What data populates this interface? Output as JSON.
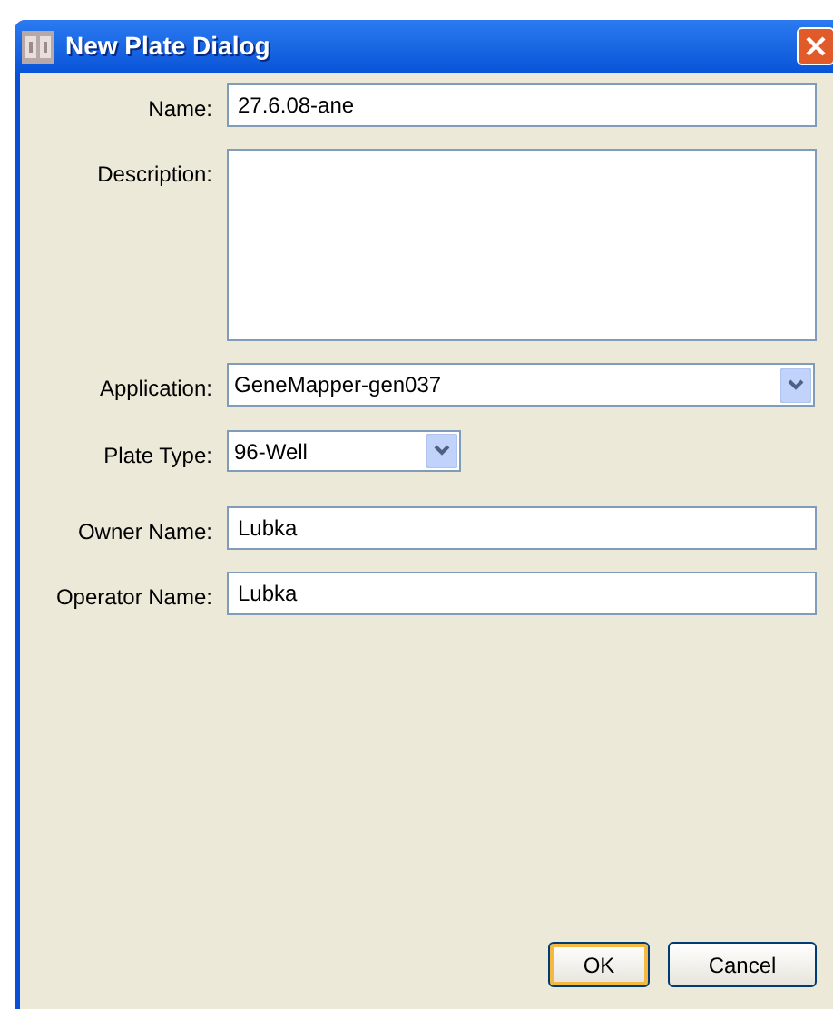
{
  "window": {
    "title": "New Plate Dialog"
  },
  "fields": [
    {
      "kind": "text",
      "label": "Name:",
      "value": "27.6.08-ane"
    },
    {
      "kind": "textarea",
      "label": "Description:"
    },
    {
      "kind": "dropdown",
      "label": "Application:",
      "value": "GeneMapper-gen037"
    },
    {
      "kind": "dropdown-short",
      "label": "Plate Type:",
      "value": "96-Well"
    },
    {
      "kind": "text",
      "label": "Owner Name:",
      "value": "Lubka"
    },
    {
      "kind": "text",
      "label": "Operator Name:",
      "value": "Lubka"
    }
  ],
  "buttons": [
    {
      "label": "OK",
      "default": true
    },
    {
      "label": "Cancel",
      "default": false
    }
  ]
}
